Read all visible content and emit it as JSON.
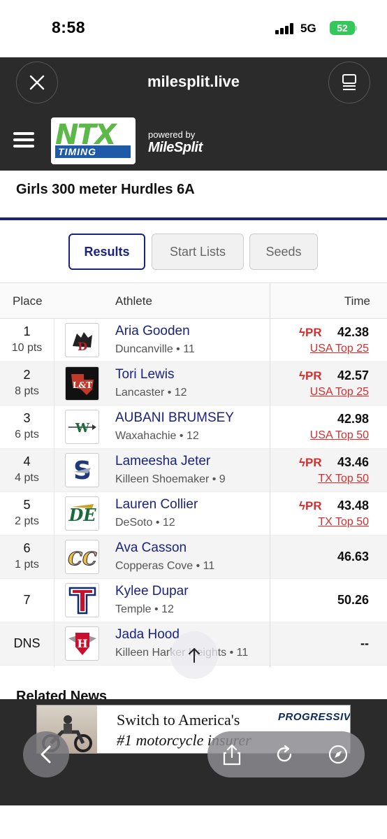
{
  "status": {
    "time": "8:58",
    "network": "5G",
    "battery": "52"
  },
  "browser": {
    "url": "milesplit.live"
  },
  "brand": {
    "logo_top": "NTX",
    "logo_bottom": "TIMING",
    "powered_by": "powered by",
    "milesplit": "MileSplit"
  },
  "event": {
    "title": "Girls 300 meter Hurdles 6A"
  },
  "tabs": [
    {
      "label": "Results",
      "active": true
    },
    {
      "label": "Start Lists",
      "active": false
    },
    {
      "label": "Seeds",
      "active": false
    }
  ],
  "table": {
    "headers": {
      "place": "Place",
      "athlete": "Athlete",
      "time": "Time"
    },
    "rows": [
      {
        "place": "1",
        "pts": "10 pts",
        "name": "Aria Gooden",
        "meta": "Duncanville • 11",
        "pr": "PR",
        "time": "42.38",
        "rank": "USA Top 25",
        "logo": "D"
      },
      {
        "place": "2",
        "pts": "8 pts",
        "name": "Tori Lewis",
        "meta": "Lancaster • 12",
        "pr": "PR",
        "time": "42.57",
        "rank": "USA Top 25",
        "logo": "LT"
      },
      {
        "place": "3",
        "pts": "6 pts",
        "name": "AUBANI BRUMSEY",
        "meta": "Waxahachie • 12",
        "pr": "",
        "time": "42.98",
        "rank": "USA Top 50",
        "logo": "W"
      },
      {
        "place": "4",
        "pts": "4 pts",
        "name": "Lameesha Jeter",
        "meta": "Killeen Shoemaker • 9",
        "pr": "PR",
        "time": "43.46",
        "rank": "TX Top 50",
        "logo": "S"
      },
      {
        "place": "5",
        "pts": "2 pts",
        "name": "Lauren Collier",
        "meta": "DeSoto • 12",
        "pr": "PR",
        "time": "43.48",
        "rank": "TX Top 50",
        "logo": "DE"
      },
      {
        "place": "6",
        "pts": "1 pts",
        "name": "Ava Casson",
        "meta": "Copperas Cove • 11",
        "pr": "",
        "time": "46.63",
        "rank": "",
        "logo": "CC"
      },
      {
        "place": "7",
        "pts": "",
        "name": "Kylee Dupar",
        "meta": "Temple • 12",
        "pr": "",
        "time": "50.26",
        "rank": "",
        "logo": "T"
      },
      {
        "place": "DNS",
        "pts": "",
        "name": "Jada Hood",
        "meta": "Killeen Harker Heights • 11",
        "pr": "",
        "time": "--",
        "rank": "",
        "logo": "H"
      }
    ]
  },
  "related": {
    "title": "Related News"
  },
  "ad": {
    "line1": "Switch to America's",
    "line2": "#1 motorcycle insurer",
    "brand": "PROGRESSIVE"
  },
  "colors": {
    "accent": "#1a237e",
    "pr": "#d32f2f",
    "header_bg": "#2b2b2b"
  }
}
